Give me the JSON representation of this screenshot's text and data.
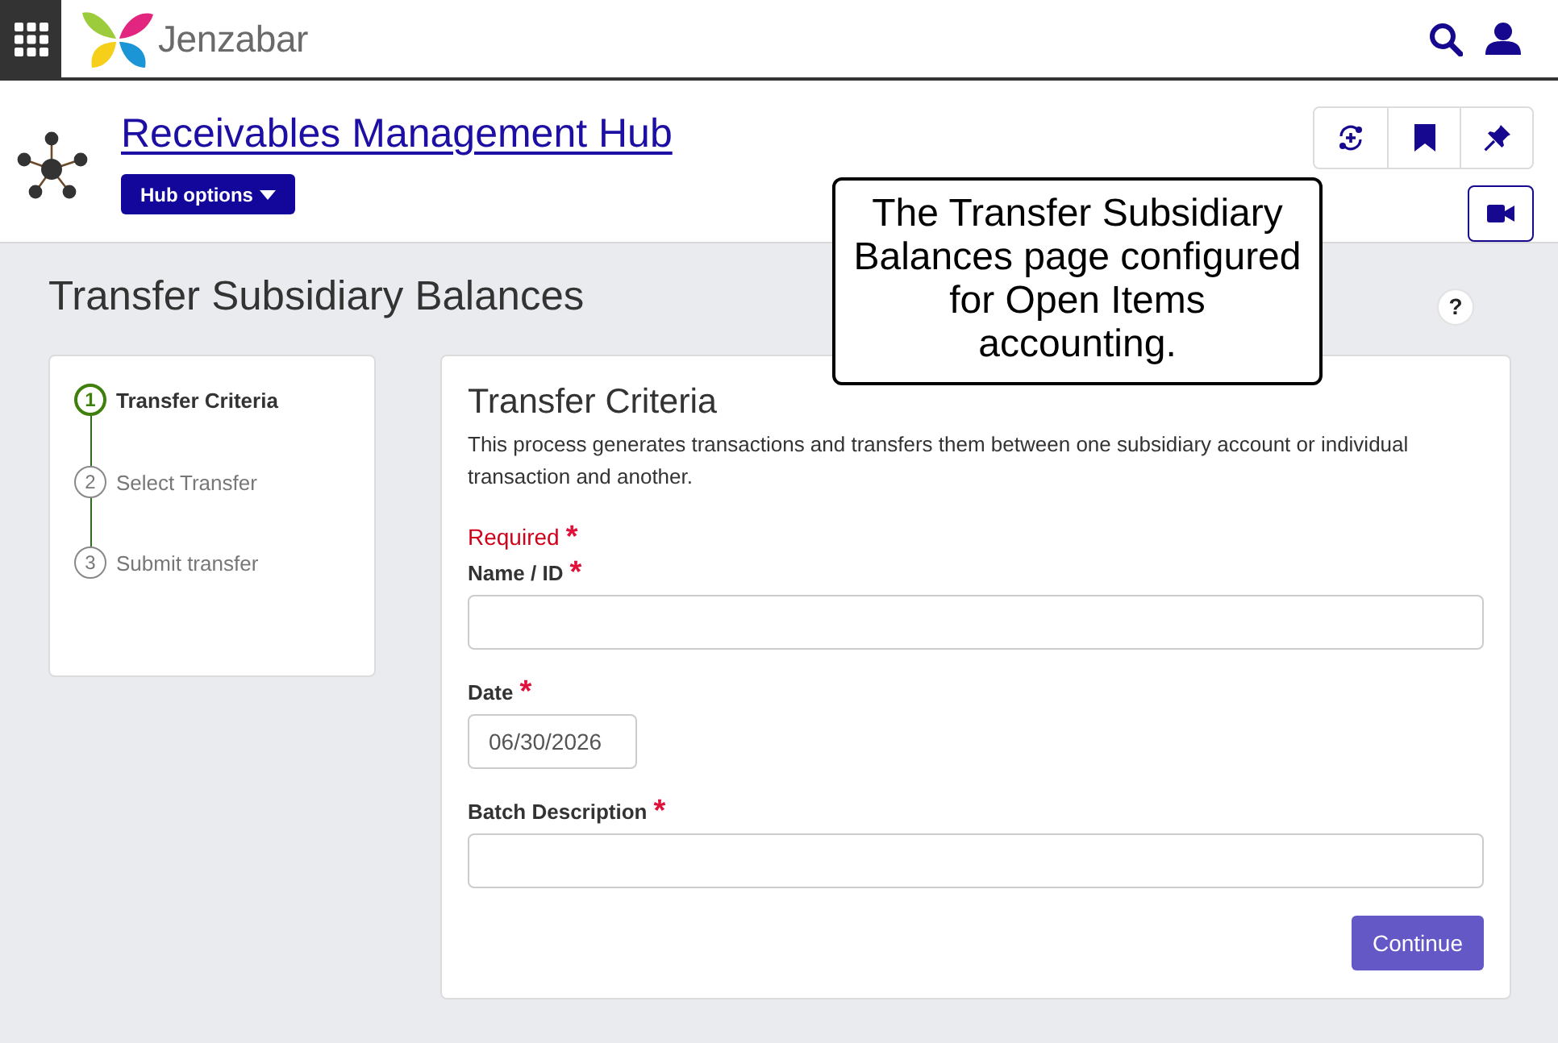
{
  "top_bar": {
    "brand": "Jenzabar"
  },
  "hub": {
    "title": "Receivables Management Hub",
    "options_button": "Hub options"
  },
  "annotation": {
    "text": "The Transfer Subsidiary Balances page configured for Open Items accounting."
  },
  "page": {
    "title": "Transfer Subsidiary Balances",
    "help": "?"
  },
  "steps": [
    {
      "number": "1",
      "label": "Transfer Criteria",
      "selected": true
    },
    {
      "number": "2",
      "label": "Select Transfer",
      "selected": false
    },
    {
      "number": "3",
      "label": "Submit transfer",
      "selected": false
    }
  ],
  "form": {
    "title": "Transfer Criteria",
    "description": "This process generates transactions and transfers them between one subsidiary account or individual transaction and another.",
    "required_legend": "Required",
    "required_mark": "*",
    "fields": [
      {
        "kind": "text",
        "label": "Name / ID",
        "required_mark": "*"
      },
      {
        "kind": "date",
        "label": "Date",
        "required_mark": "*",
        "value": "06/30/2026"
      },
      {
        "kind": "text",
        "label": "Batch Description",
        "required_mark": "*"
      }
    ],
    "submit_button": "Continue"
  }
}
